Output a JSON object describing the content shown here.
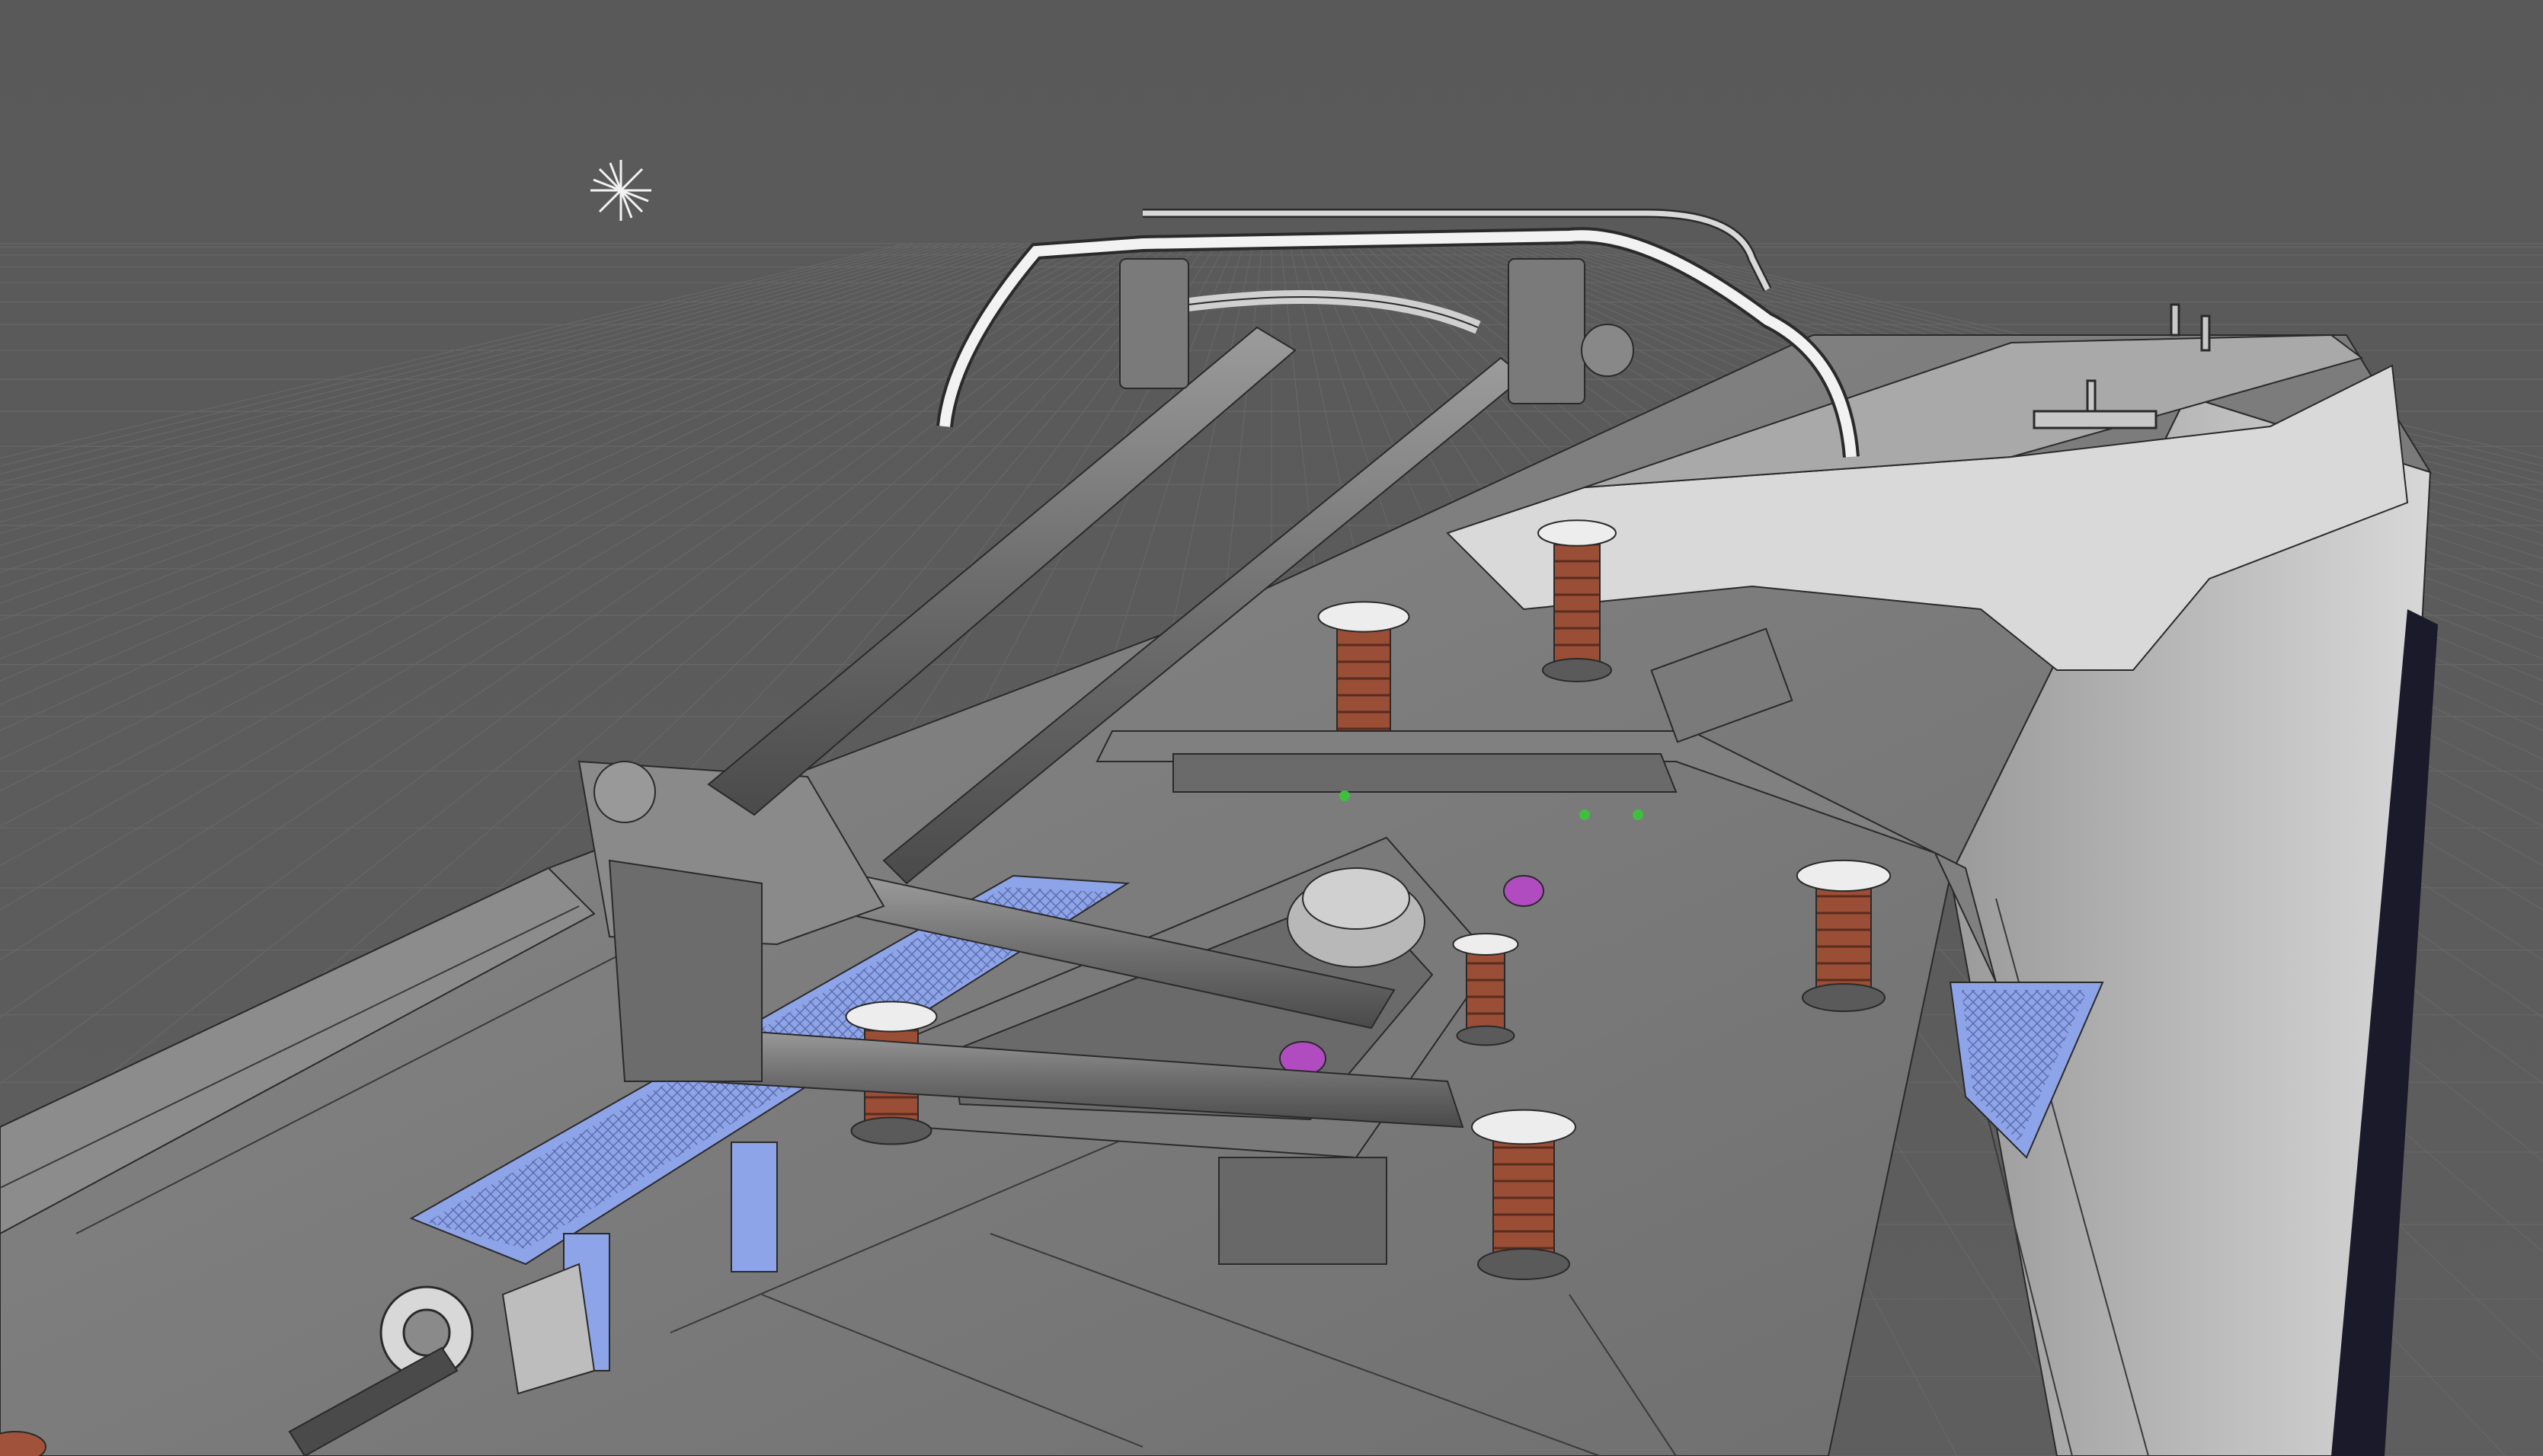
{
  "viewport": {
    "background_color": "#5b5b5b",
    "grid_color": "#6a6a6a",
    "wire_color": "#2a2a2a",
    "highlight_color": "#f2f2f2",
    "insulator_color": "#a0523a",
    "walkway_color": "#8ea4e8",
    "accent_green": "#3fbf3f",
    "accent_magenta": "#b04cc0"
  },
  "scene": {
    "subject": "pantograph-on-locomotive-roof"
  },
  "icons": {
    "light": "light-star-icon"
  }
}
